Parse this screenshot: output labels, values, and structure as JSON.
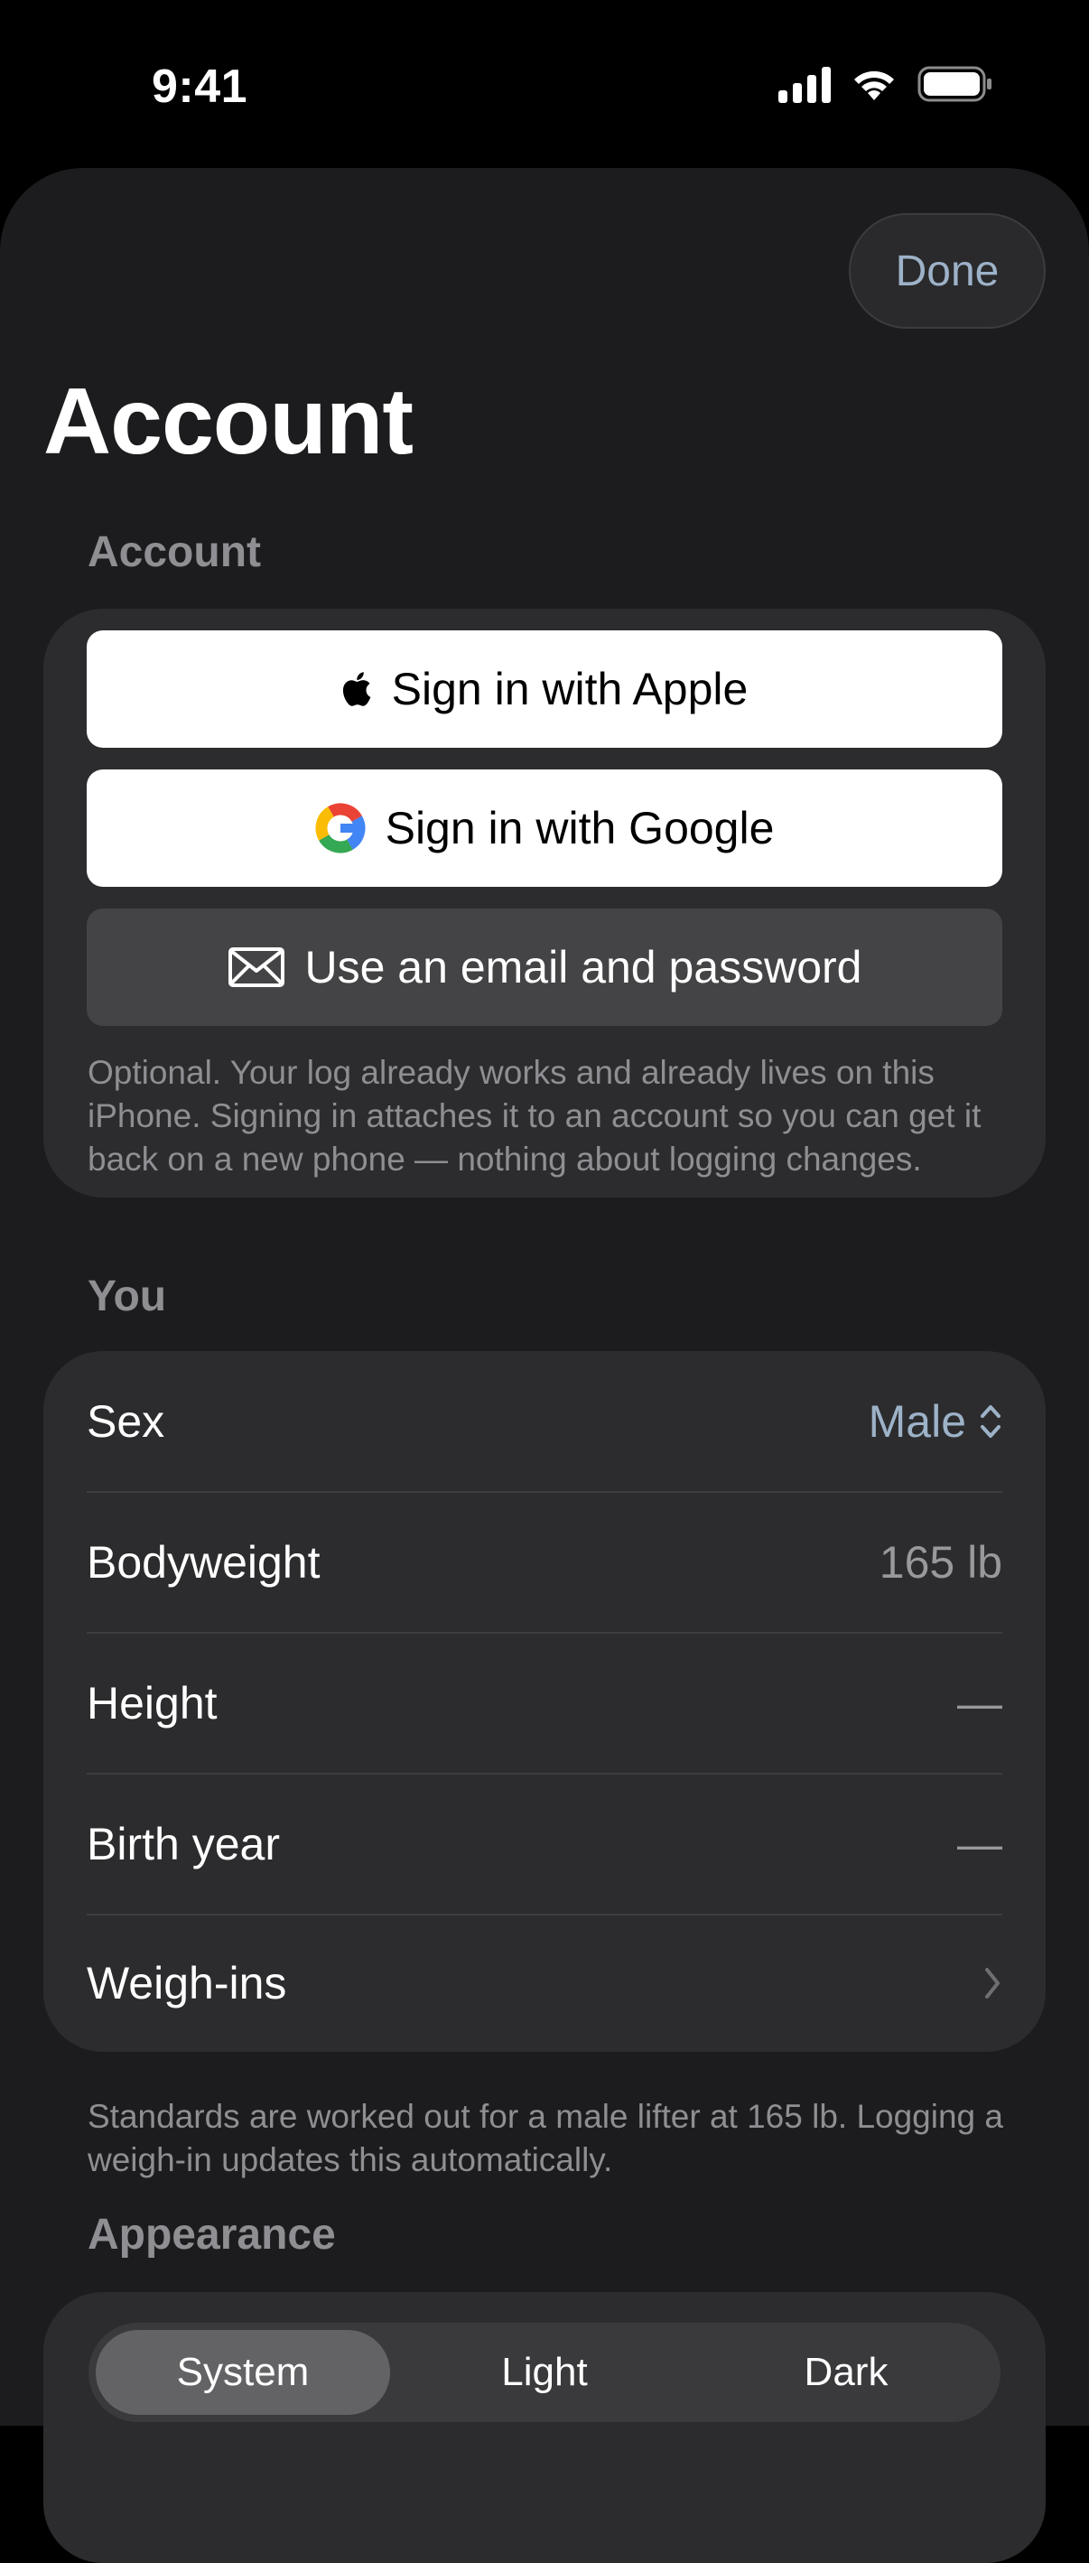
{
  "status_bar": {
    "time": "9:41"
  },
  "sheet": {
    "done_label": "Done",
    "title": "Account"
  },
  "account": {
    "header": "Account",
    "apple_label": "Sign in with Apple",
    "google_label": "Sign in with Google",
    "email_label": "Use an email and password",
    "footnote": "Optional. Your log already works and already lives on this iPhone. Signing in attaches it to an account so you can get it back on a new phone — nothing about logging changes."
  },
  "you": {
    "header": "You",
    "rows": [
      {
        "label": "Sex",
        "value": "Male"
      },
      {
        "label": "Bodyweight",
        "value": "165 lb"
      },
      {
        "label": "Height",
        "value": "—"
      },
      {
        "label": "Birth year",
        "value": "—"
      },
      {
        "label": "Weigh-ins",
        "value": ""
      }
    ],
    "footnote": "Standards are worked out for a male lifter at 165 lb. Logging a weigh-in updates this automatically."
  },
  "appearance": {
    "header": "Appearance",
    "options": [
      "System",
      "Light",
      "Dark"
    ],
    "selected": "System"
  },
  "colors": {
    "accent": "#9db2c8",
    "sheet_background": "#1c1c1e",
    "card_background": "#2c2c2e"
  }
}
